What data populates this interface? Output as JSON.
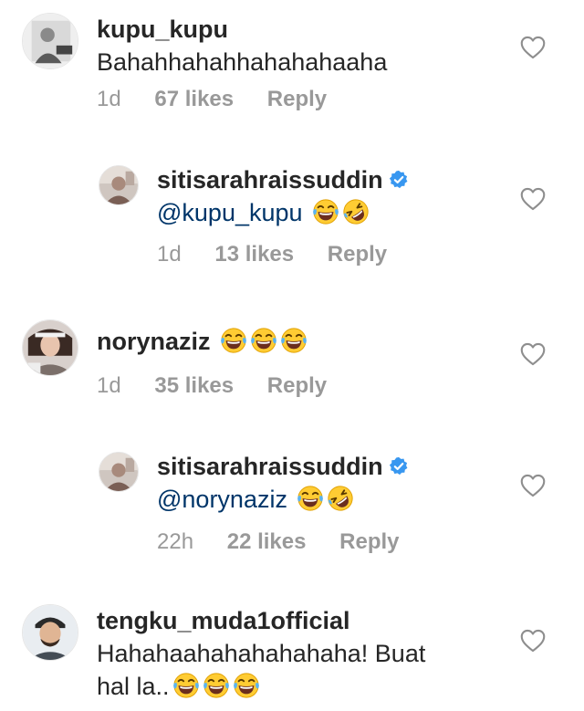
{
  "comments": [
    {
      "username": "kupu_kupu",
      "text": "Bahahhahahhahahahaaha",
      "emoji_count": 0,
      "time": "1d",
      "likes": "67 likes",
      "reply": "Reply",
      "verified": false
    },
    {
      "username": "sitisarahraissuddin",
      "mention": "@kupu_kupu",
      "emojis": [
        "face-with-tears-of-joy-emoji",
        "rolling-on-floor-laughing-emoji"
      ],
      "time": "1d",
      "likes": "13 likes",
      "reply": "Reply",
      "verified": true
    },
    {
      "username": "norynaziz",
      "emojis": [
        "face-with-tears-of-joy-emoji",
        "face-with-tears-of-joy-emoji",
        "face-with-tears-of-joy-emoji"
      ],
      "time": "1d",
      "likes": "35 likes",
      "reply": "Reply",
      "verified": false
    },
    {
      "username": "sitisarahraissuddin",
      "mention": "@norynaziz",
      "emojis": [
        "face-with-tears-of-joy-emoji",
        "rolling-on-floor-laughing-emoji"
      ],
      "time": "22h",
      "likes": "22 likes",
      "reply": "Reply",
      "verified": true
    },
    {
      "username": "tengku_muda1official",
      "text_line1": "Hahahaahahahahahaha! Buat",
      "text_line2": "hal la..",
      "emojis": [
        "face-with-tears-of-joy-emoji",
        "face-with-tears-of-joy-emoji",
        "face-with-tears-of-joy-emoji"
      ],
      "verified": false
    }
  ],
  "colors": {
    "text": "#262626",
    "meta": "#999999",
    "mention": "#003569",
    "verified": "#3897f0",
    "heart_outline": "#8e8e8e"
  },
  "icons": {
    "like": "heart-outline-icon",
    "verified": "verified-badge-icon"
  }
}
